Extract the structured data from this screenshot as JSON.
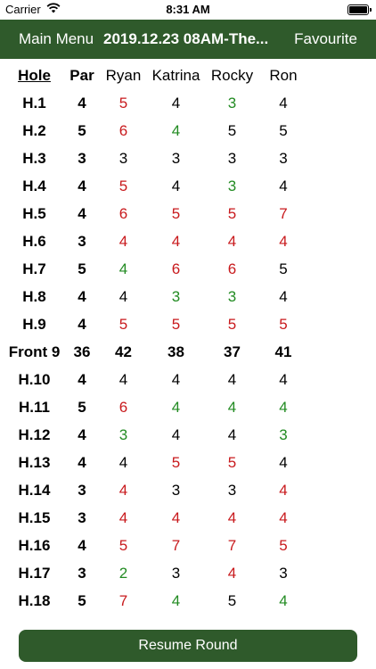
{
  "status_bar": {
    "carrier": "Carrier",
    "time": "8:31 AM"
  },
  "navbar": {
    "left_label": "Main Menu",
    "title": "2019.12.23 08AM-The...",
    "right_label": "Favourite",
    "color": "#2f5a2b"
  },
  "table": {
    "headers": [
      "Hole",
      "Par",
      "Ryan",
      "Katrina",
      "Rocky",
      "Ron"
    ],
    "rows": [
      {
        "hole": "H.1",
        "par": "4",
        "scores": [
          "5",
          "4",
          "3",
          "4"
        ]
      },
      {
        "hole": "H.2",
        "par": "5",
        "scores": [
          "6",
          "4",
          "5",
          "5"
        ]
      },
      {
        "hole": "H.3",
        "par": "3",
        "scores": [
          "3",
          "3",
          "3",
          "3"
        ]
      },
      {
        "hole": "H.4",
        "par": "4",
        "scores": [
          "5",
          "4",
          "3",
          "4"
        ]
      },
      {
        "hole": "H.5",
        "par": "4",
        "scores": [
          "6",
          "5",
          "5",
          "7"
        ]
      },
      {
        "hole": "H.6",
        "par": "3",
        "scores": [
          "4",
          "4",
          "4",
          "4"
        ]
      },
      {
        "hole": "H.7",
        "par": "5",
        "scores": [
          "4",
          "6",
          "6",
          "5"
        ]
      },
      {
        "hole": "H.8",
        "par": "4",
        "scores": [
          "4",
          "3",
          "3",
          "4"
        ]
      },
      {
        "hole": "H.9",
        "par": "4",
        "scores": [
          "5",
          "5",
          "5",
          "5"
        ]
      },
      {
        "hole": "Front 9",
        "par": "36",
        "scores": [
          "42",
          "38",
          "37",
          "41"
        ],
        "total": true
      },
      {
        "hole": "H.10",
        "par": "4",
        "scores": [
          "4",
          "4",
          "4",
          "4"
        ]
      },
      {
        "hole": "H.11",
        "par": "5",
        "scores": [
          "6",
          "4",
          "4",
          "4"
        ]
      },
      {
        "hole": "H.12",
        "par": "4",
        "scores": [
          "3",
          "4",
          "4",
          "3"
        ]
      },
      {
        "hole": "H.13",
        "par": "4",
        "scores": [
          "4",
          "5",
          "5",
          "4"
        ]
      },
      {
        "hole": "H.14",
        "par": "3",
        "scores": [
          "4",
          "3",
          "3",
          "4"
        ]
      },
      {
        "hole": "H.15",
        "par": "3",
        "scores": [
          "4",
          "4",
          "4",
          "4"
        ]
      },
      {
        "hole": "H.16",
        "par": "4",
        "scores": [
          "5",
          "7",
          "7",
          "5"
        ]
      },
      {
        "hole": "H.17",
        "par": "3",
        "scores": [
          "2",
          "3",
          "4",
          "3"
        ]
      },
      {
        "hole": "H.18",
        "par": "5",
        "scores": [
          "7",
          "4",
          "5",
          "4"
        ]
      }
    ],
    "colors": {
      "over_par": "#c8191c",
      "under_par": "#228b22",
      "even": "#000000"
    }
  },
  "resume_button": {
    "label": "Resume Round"
  }
}
